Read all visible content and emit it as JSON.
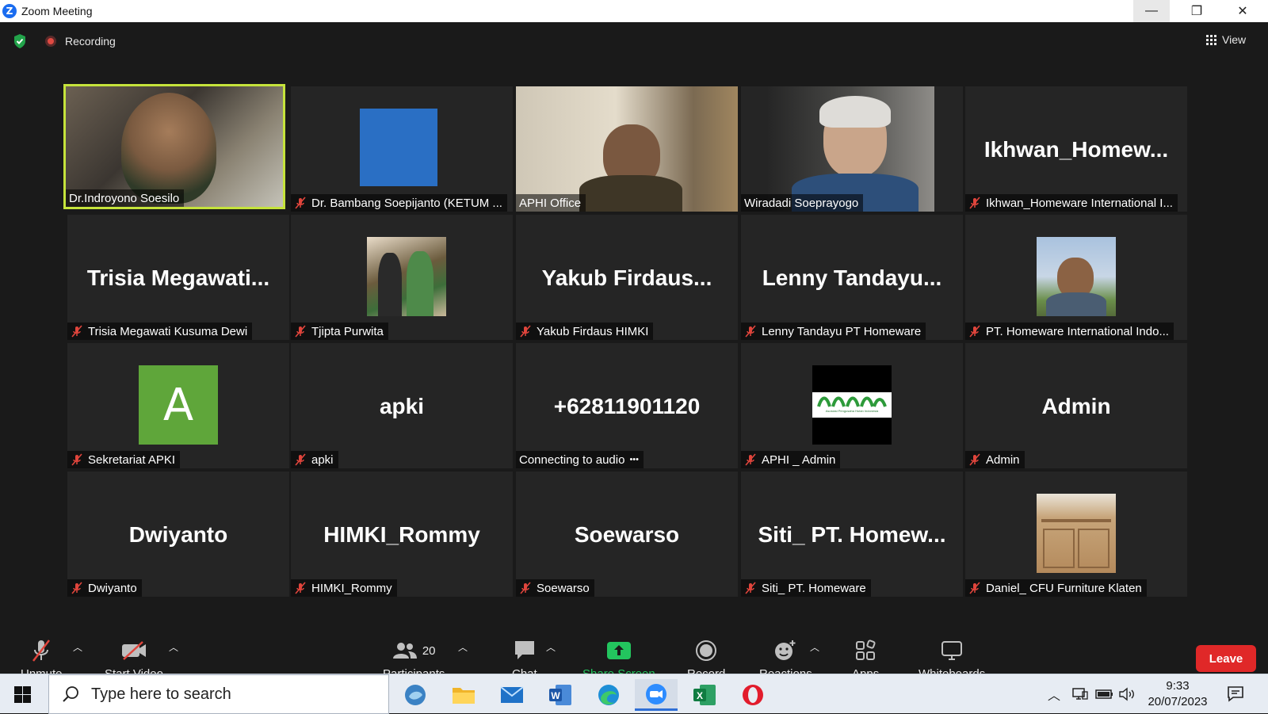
{
  "window": {
    "title": "Zoom Meeting",
    "min": "—",
    "max": "❐",
    "close": "✕"
  },
  "topbar": {
    "recording_label": "Recording",
    "view_label": "View"
  },
  "tiles": [
    {
      "name": "Dr.Indroyono Soesilo",
      "display": "",
      "muted": false,
      "active": true
    },
    {
      "name": "Dr. Bambang Soepijanto (KETUM ...",
      "display": "",
      "muted": true
    },
    {
      "name": "APHI Office",
      "display": "",
      "muted": false
    },
    {
      "name": "Wiradadi Soeprayogo",
      "display": "",
      "muted": false
    },
    {
      "name": "Ikhwan_Homeware International I...",
      "display": "Ikhwan_Homew...",
      "muted": true
    },
    {
      "name": "Trisia Megawati Kusuma Dewi",
      "display": "Trisia  Megawati...",
      "muted": true
    },
    {
      "name": "Tjipta Purwita",
      "display": "",
      "muted": true
    },
    {
      "name": "Yakub Firdaus HIMKI",
      "display": "Yakub  Firdaus...",
      "muted": true
    },
    {
      "name": "Lenny Tandayu PT Homeware",
      "display": "Lenny  Tandayu...",
      "muted": true
    },
    {
      "name": "PT. Homeware International Indo...",
      "display": "",
      "muted": true
    },
    {
      "name": "Sekretariat APKI",
      "display": "",
      "avatar_letter": "A",
      "muted": true
    },
    {
      "name": "apki",
      "display": "apki",
      "muted": true
    },
    {
      "name": "Connecting to audio",
      "display": "+62811901120",
      "muted": false,
      "connecting": "•••"
    },
    {
      "name": "APHI _ Admin",
      "display": "",
      "muted": true,
      "logo_caption": "Asosiasi Pengusaha Hutan Indonesia"
    },
    {
      "name": "Admin",
      "display": "Admin",
      "muted": true
    },
    {
      "name": "Dwiyanto",
      "display": "Dwiyanto",
      "muted": true
    },
    {
      "name": "HIMKI_Rommy",
      "display": "HIMKI_Rommy",
      "muted": true
    },
    {
      "name": "Soewarso",
      "display": "Soewarso",
      "muted": true
    },
    {
      "name": "Siti_ PT. Homeware",
      "display": "Siti_  PT. Homew...",
      "muted": true
    },
    {
      "name": "Daniel_ CFU Furniture Klaten",
      "display": "",
      "muted": true
    }
  ],
  "toolbar": {
    "unmute": "Unmute",
    "start_video": "Start Video",
    "participants": "Participants",
    "participants_count": "20",
    "chat": "Chat",
    "share_screen": "Share Screen",
    "record": "Record",
    "reactions": "Reactions",
    "apps": "Apps",
    "whiteboards": "Whiteboards",
    "leave": "Leave"
  },
  "taskbar": {
    "search_placeholder": "Type here to search",
    "time": "9:33",
    "date": "20/07/2023"
  },
  "colors": {
    "active_speaker": "#c5e33b",
    "share_green": "#23c55e",
    "leave_red": "#e02828",
    "mute_red": "#e0453c"
  }
}
